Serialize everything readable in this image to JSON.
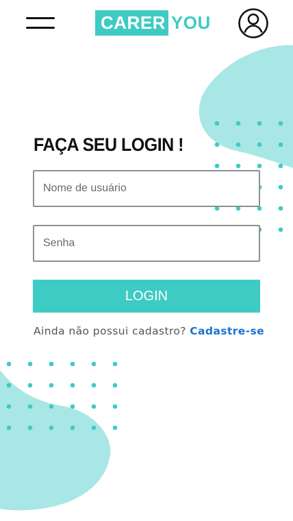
{
  "header": {
    "logo_part_a": "CARER",
    "logo_part_b": "YOU",
    "menu_icon": "hamburger-menu-icon",
    "account_icon": "user-account-icon"
  },
  "login": {
    "title": "FAÇA SEU LOGIN !",
    "username_placeholder": "Nome de usuário",
    "password_placeholder": "Senha",
    "submit_label": "LOGIN",
    "signup_prompt": "Ainda não possui cadastro?",
    "signup_link": "Cadastre-se"
  },
  "colors": {
    "accent": "#3ecbc3",
    "blob": "#a8e7e5",
    "link": "#1a73d1",
    "field_border": "#8e8e96",
    "text": "#111111"
  }
}
